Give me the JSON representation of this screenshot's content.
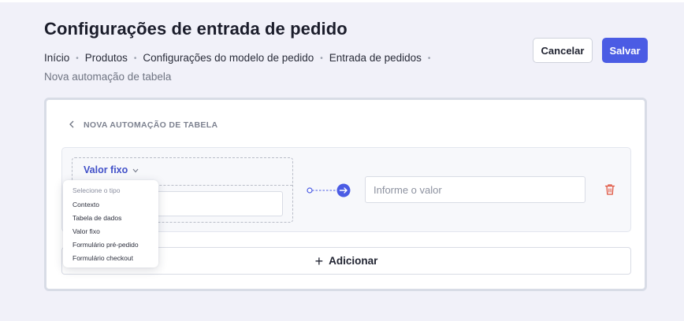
{
  "header": {
    "title": "Configurações de entrada de pedido",
    "breadcrumb": [
      "Início",
      "Produtos",
      "Configurações do modelo de pedido",
      "Entrada de pedidos"
    ],
    "breadcrumb_current": "Nova automação de tabela",
    "cancel_label": "Cancelar",
    "save_label": "Salvar"
  },
  "card": {
    "back_icon": "chevron-left-icon",
    "section_title": "NOVA AUTOMAÇÃO DE TABELA",
    "source": {
      "type_selected": "Valor fixo",
      "chevron": "⌄"
    },
    "value_placeholder": "Informe o valor",
    "add_label": "Adicionar"
  },
  "dropdown": {
    "header": "Selecione o tipo",
    "options": [
      "Contexto",
      "Tabela de dados",
      "Valor fixo",
      "Formulário pré-pedido",
      "Formulário checkout"
    ]
  },
  "colors": {
    "accent": "#4b5ce4",
    "delete": "#e0533e",
    "background": "#f1f1f9"
  }
}
